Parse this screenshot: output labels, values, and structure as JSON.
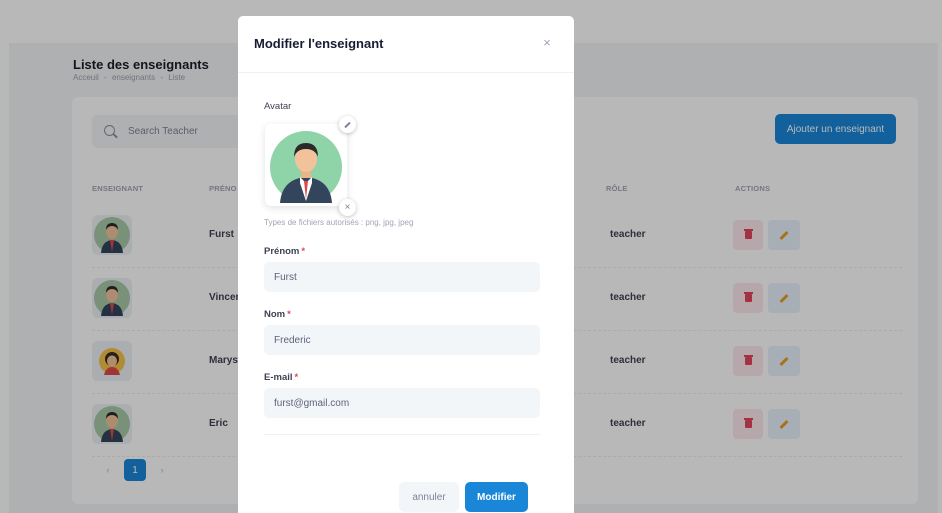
{
  "page": {
    "title": "Liste des enseignants",
    "breadcrumb": [
      "Acceuil",
      "-",
      "enseignants",
      "-",
      "Liste"
    ]
  },
  "toolbar": {
    "search_placeholder": "Search Teacher",
    "add_button_label": "Ajouter un enseignant"
  },
  "table": {
    "columns": [
      "ENSEIGNANT",
      "PRÉNO",
      "RÔLE",
      "ACTIONS"
    ],
    "rows": [
      {
        "first_name": "Furst",
        "role": "teacher",
        "avatar": "male-avatar"
      },
      {
        "first_name": "Vincen",
        "role": "teacher",
        "avatar": "male-avatar"
      },
      {
        "first_name": "Maryse",
        "role": "teacher",
        "avatar": "female-avatar"
      },
      {
        "first_name": "Eric",
        "role": "teacher",
        "avatar": "male-avatar"
      }
    ]
  },
  "pagination": {
    "prev": "‹",
    "current": "1",
    "next": "›"
  },
  "modal": {
    "title": "Modifier l'enseignant",
    "close_icon": "×",
    "avatar_label": "Avatar",
    "remove_icon": "×",
    "file_hint": "Types de fichiers autorisés : png, jpg, jpeg",
    "first_name_label": "Prénom",
    "first_name_value": "Furst",
    "last_name_label": "Nom",
    "last_name_value": "Frederic",
    "email_label": "E-mail",
    "email_value": "furst@gmail.com",
    "required_mark": "*",
    "cancel_label": "annuler",
    "submit_label": "Modifier"
  },
  "colors": {
    "accent": "#1a86d8",
    "danger": "#e2455c",
    "warning": "#e0a222"
  }
}
